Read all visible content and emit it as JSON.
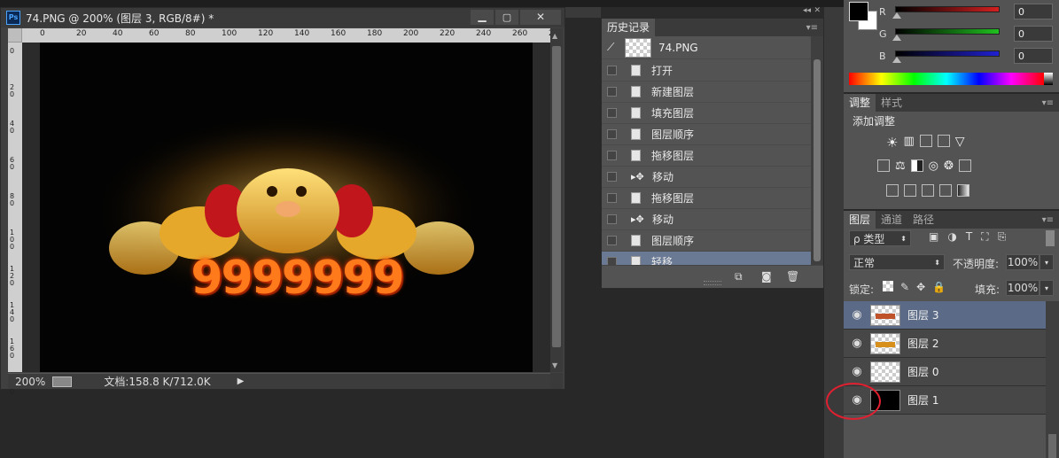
{
  "doc_window": {
    "title": "74.PNG @ 200% (图层 3, RGB/8#) *",
    "app_icon": "Ps",
    "ruler_h": [
      "0",
      "20",
      "40",
      "60",
      "80",
      "100",
      "120",
      "140",
      "160",
      "180",
      "200",
      "220",
      "240",
      "260",
      "28"
    ],
    "ruler_v": [
      "0",
      "2\n0",
      "4\n0",
      "6\n0",
      "8\n0",
      "1\n0\n0",
      "1\n2\n0",
      "1\n4\n0",
      "1\n6\n0",
      "1\n8\n0"
    ],
    "artwork_number": "9999999",
    "status_zoom": "200%",
    "status_doc": "文档:158.8 K/712.0K"
  },
  "history": {
    "tab": "历史记录",
    "snapshot": "74.PNG",
    "items": [
      {
        "label": "打开",
        "type": "doc"
      },
      {
        "label": "新建图层",
        "type": "doc"
      },
      {
        "label": "填充图层",
        "type": "doc"
      },
      {
        "label": "图层顺序",
        "type": "doc"
      },
      {
        "label": "拖移图层",
        "type": "doc"
      },
      {
        "label": "移动",
        "type": "move"
      },
      {
        "label": "拖移图层",
        "type": "doc"
      },
      {
        "label": "移动",
        "type": "move"
      },
      {
        "label": "图层顺序",
        "type": "doc"
      },
      {
        "label": "轻移",
        "type": "doc",
        "active": true
      }
    ]
  },
  "color": {
    "channels": [
      {
        "name": "R",
        "value": "0",
        "bar": "#d42020"
      },
      {
        "name": "G",
        "value": "0",
        "bar": "#20c020"
      },
      {
        "name": "B",
        "value": "0",
        "bar": "#2020d0"
      }
    ]
  },
  "adjust": {
    "tabs": [
      "调整",
      "样式"
    ],
    "heading": "添加调整"
  },
  "layers": {
    "tabs": [
      "图层",
      "通道",
      "路径"
    ],
    "filter_kind": "ρ 类型",
    "blend_mode": "正常",
    "opacity_label": "不透明度:",
    "opacity_value": "100%",
    "lock_label": "锁定:",
    "fill_label": "填充:",
    "fill_value": "100%",
    "items": [
      {
        "name": "图层 3",
        "active": true
      },
      {
        "name": "图层 2",
        "active": false
      },
      {
        "name": "图层 0",
        "active": false
      },
      {
        "name": "图层 1",
        "active": false
      }
    ]
  },
  "colors": {
    "selection": "#6a7a94",
    "annotation": "#e02030"
  }
}
